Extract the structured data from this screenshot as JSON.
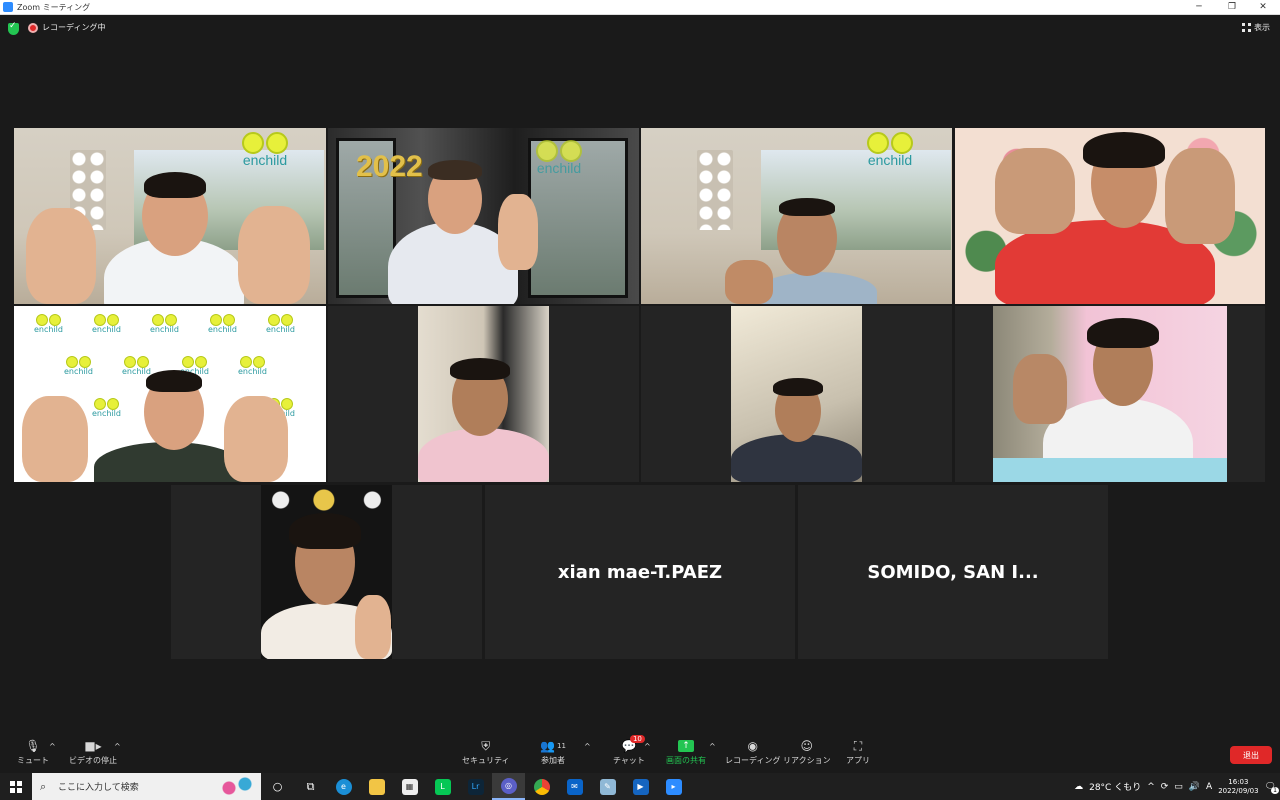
{
  "window": {
    "title": "Zoom ミーティング"
  },
  "top_bar": {
    "recording_label": "レコーディング中",
    "view_label": "表示"
  },
  "tiles": {
    "name_tile_1": "xian mae-T.PAEZ",
    "name_tile_2": "SOMIDO, SAN I...",
    "logo_text": "enchild",
    "year_text": "2022"
  },
  "toolbar": {
    "mute_label": "ミュート",
    "video_label": "ビデオの停止",
    "security_label": "セキュリティ",
    "participants_label": "参加者",
    "participants_count": "11",
    "chat_label": "チャット",
    "chat_badge": "10",
    "share_label": "画面の共有",
    "record_label": "レコーディング",
    "reaction_label": "リアクション",
    "apps_label": "アプリ",
    "end_label": "退出"
  },
  "taskbar": {
    "search_placeholder": "ここに入力して検索",
    "weather": "28°C くもり",
    "ime": "A",
    "time": "16:03",
    "date": "2022/09/03",
    "notification_count": "1"
  },
  "colors": {
    "active_speaker": "#c8e63c",
    "share_green": "#23c552",
    "end_red": "#e02828",
    "zoom_blue": "#2d8cff"
  }
}
